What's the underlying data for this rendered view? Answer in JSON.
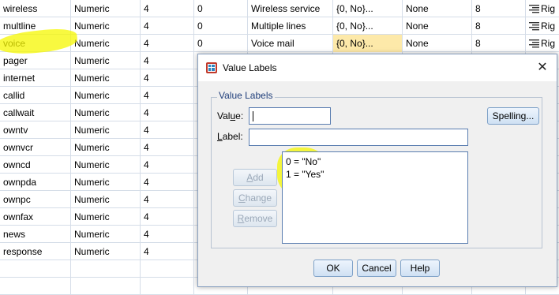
{
  "grid": {
    "rows": [
      {
        "name": "wireless",
        "type": "Numeric",
        "width": "4",
        "decimals": "0",
        "label": "Wireless service",
        "values": "{0, No}...",
        "missing": "None",
        "columns": "8",
        "align": "Rig"
      },
      {
        "name": "multline",
        "type": "Numeric",
        "width": "4",
        "decimals": "0",
        "label": "Multiple lines",
        "values": "{0, No}...",
        "missing": "None",
        "columns": "8",
        "align": "Rig"
      },
      {
        "name": "voice",
        "type": "Numeric",
        "width": "4",
        "decimals": "0",
        "label": "Voice mail",
        "values": "{0, No}...",
        "missing": "None",
        "columns": "8",
        "align": "Rig"
      },
      {
        "name": "pager",
        "type": "Numeric",
        "width": "4",
        "decimals": "",
        "label": "",
        "values": "",
        "missing": "",
        "columns": "",
        "align": ""
      },
      {
        "name": "internet",
        "type": "Numeric",
        "width": "4",
        "decimals": "",
        "label": "",
        "values": "",
        "missing": "",
        "columns": "",
        "align": ""
      },
      {
        "name": "callid",
        "type": "Numeric",
        "width": "4",
        "decimals": "",
        "label": "",
        "values": "",
        "missing": "",
        "columns": "",
        "align": ""
      },
      {
        "name": "callwait",
        "type": "Numeric",
        "width": "4",
        "decimals": "",
        "label": "",
        "values": "",
        "missing": "",
        "columns": "",
        "align": ""
      },
      {
        "name": "owntv",
        "type": "Numeric",
        "width": "4",
        "decimals": "",
        "label": "",
        "values": "",
        "missing": "",
        "columns": "",
        "align": ""
      },
      {
        "name": "ownvcr",
        "type": "Numeric",
        "width": "4",
        "decimals": "",
        "label": "",
        "values": "",
        "missing": "",
        "columns": "",
        "align": ""
      },
      {
        "name": "owncd",
        "type": "Numeric",
        "width": "4",
        "decimals": "",
        "label": "",
        "values": "",
        "missing": "",
        "columns": "",
        "align": ""
      },
      {
        "name": "ownpda",
        "type": "Numeric",
        "width": "4",
        "decimals": "",
        "label": "",
        "values": "",
        "missing": "",
        "columns": "",
        "align": ""
      },
      {
        "name": "ownpc",
        "type": "Numeric",
        "width": "4",
        "decimals": "",
        "label": "",
        "values": "",
        "missing": "",
        "columns": "",
        "align": ""
      },
      {
        "name": "ownfax",
        "type": "Numeric",
        "width": "4",
        "decimals": "",
        "label": "",
        "values": "",
        "missing": "",
        "columns": "",
        "align": ""
      },
      {
        "name": "news",
        "type": "Numeric",
        "width": "4",
        "decimals": "",
        "label": "",
        "values": "",
        "missing": "",
        "columns": "",
        "align": ""
      },
      {
        "name": "response",
        "type": "Numeric",
        "width": "4",
        "decimals": "",
        "label": "",
        "values": "",
        "missing": "",
        "columns": "",
        "align": ""
      },
      {
        "name": "",
        "type": "",
        "width": "",
        "decimals": "",
        "label": "",
        "values": "",
        "missing": "",
        "columns": "",
        "align": ""
      },
      {
        "name": "",
        "type": "",
        "width": "",
        "decimals": "",
        "label": "",
        "values": "",
        "missing": "",
        "columns": "",
        "align": ""
      }
    ],
    "selected_values_row": 2,
    "align_icon": "align-right-icon"
  },
  "dialog": {
    "title": "Value Labels",
    "title_icon": "value-labels-app-icon",
    "close_icon": "close-icon",
    "group_title": "Value Labels",
    "value_label_prefix": "Val",
    "value_label_key": "u",
    "value_label_suffix": "e:",
    "value_input": "",
    "label_label_key": "L",
    "label_label_suffix": "abel:",
    "label_input": "",
    "spelling": "Spelling...",
    "add_key": "A",
    "add_rest": "dd",
    "change_key": "C",
    "change_rest": "hange",
    "remove_key": "R",
    "remove_rest": "emove",
    "labels_list": [
      "0 = \"No\"",
      "1 = \"Yes\""
    ],
    "ok": "OK",
    "cancel": "Cancel",
    "help": "Help"
  },
  "colors": {
    "highlight": "#f5f700",
    "selected_cell": "#fde9a9",
    "accent": "#1f3e7a"
  }
}
